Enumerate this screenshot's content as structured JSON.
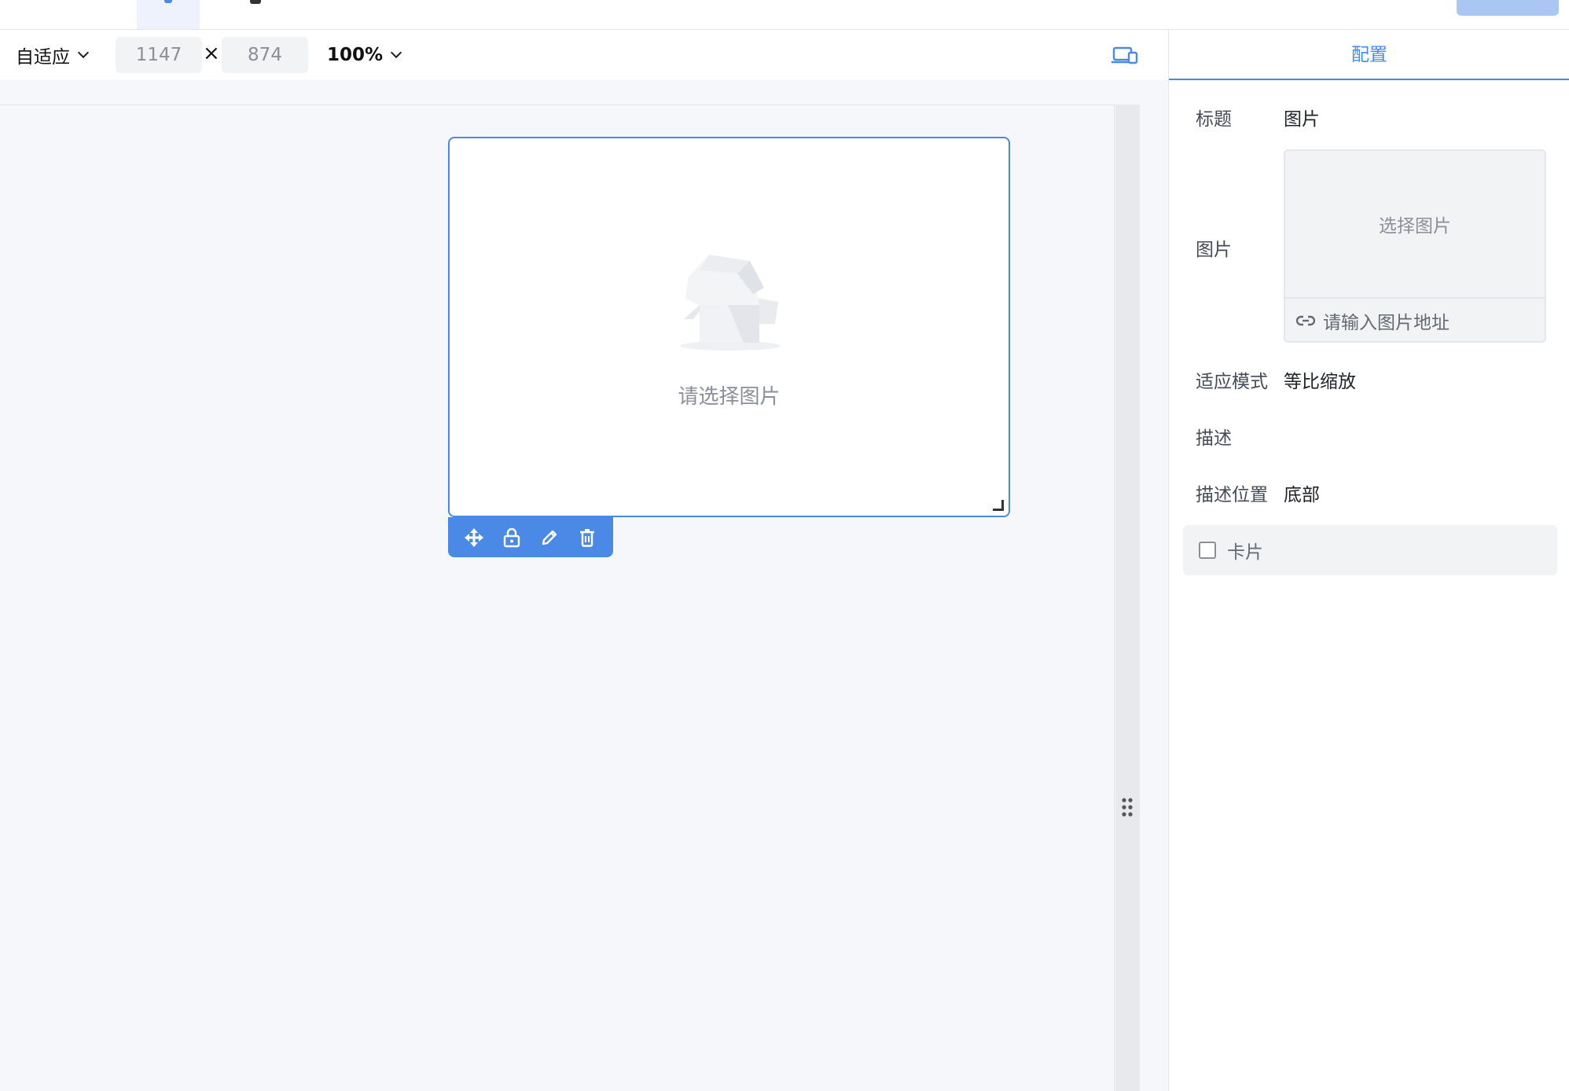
{
  "toolbar": {
    "adapt_label": "自适应",
    "width_value": "1147",
    "times_symbol": "×",
    "height_value": "874",
    "zoom_label": "100%"
  },
  "widget": {
    "placeholder_text": "请选择图片"
  },
  "panel": {
    "tab_label": "配置",
    "title_label": "标题",
    "title_value": "图片",
    "image_label": "图片",
    "choose_image": "选择图片",
    "url_placeholder": "请输入图片地址",
    "fit_label": "适应模式",
    "fit_value": "等比缩放",
    "desc_label": "描述",
    "desc_pos_label": "描述位置",
    "desc_pos_value": "底部",
    "card_label": "卡片"
  },
  "colors": {
    "accent": "#4a8ae6",
    "canvas_bg": "#f5f7fa"
  }
}
